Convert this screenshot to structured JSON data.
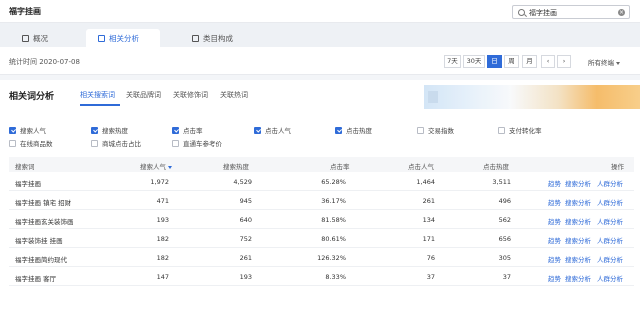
{
  "header": {
    "title": "福字挂画",
    "search_value": "福字挂画"
  },
  "main_tabs": [
    {
      "label": "概况",
      "icon": "overview-icon"
    },
    {
      "label": "相关分析",
      "icon": "analysis-icon"
    },
    {
      "label": "类目构成",
      "icon": "category-icon"
    }
  ],
  "active_main_tab": 1,
  "timebar": {
    "stat_time": "统计时间 2020-07-08",
    "periods": [
      "7天",
      "30天",
      "日",
      "周",
      "月"
    ],
    "active_period": 2,
    "prev": "‹",
    "next": "›",
    "terminal": "所有终端"
  },
  "section": {
    "title": "相关词分析",
    "sub_tabs": [
      "相关搜索词",
      "关联品牌词",
      "关联修饰词",
      "关联热词"
    ],
    "active_sub_tab": 0
  },
  "metrics": [
    {
      "label": "搜索人气",
      "checked": true
    },
    {
      "label": "搜索热度",
      "checked": true
    },
    {
      "label": "点击率",
      "checked": true
    },
    {
      "label": "点击人气",
      "checked": true
    },
    {
      "label": "点击热度",
      "checked": true
    },
    {
      "label": "交易指数",
      "checked": false
    },
    {
      "label": "支付转化率",
      "checked": false
    },
    {
      "label": "在线商品数",
      "checked": false
    },
    {
      "label": "商城点击占比",
      "checked": false
    },
    {
      "label": "直通车参考价",
      "checked": false
    }
  ],
  "table": {
    "columns": [
      "搜索词",
      "搜索人气",
      "搜索热度",
      "点击率",
      "点击人气",
      "点击热度",
      "操作"
    ],
    "actions": [
      "趋势",
      "搜索分析",
      "人群分析"
    ],
    "rows": [
      [
        "福字挂画",
        "1,972",
        "4,529",
        "65.28%",
        "1,464",
        "3,511"
      ],
      [
        "福字挂画 镇宅 招财",
        "471",
        "945",
        "36.17%",
        "261",
        "496"
      ],
      [
        "福字挂画玄关装饰画",
        "193",
        "640",
        "81.58%",
        "134",
        "562"
      ],
      [
        "福字装饰挂 挂画",
        "182",
        "752",
        "80.61%",
        "171",
        "656"
      ],
      [
        "福字挂画简约现代",
        "182",
        "261",
        "126.32%",
        "76",
        "305"
      ],
      [
        "福字挂画 客厅",
        "147",
        "193",
        "8.33%",
        "37",
        "37"
      ]
    ]
  },
  "colors": {
    "accent": "#2f6bd8"
  }
}
